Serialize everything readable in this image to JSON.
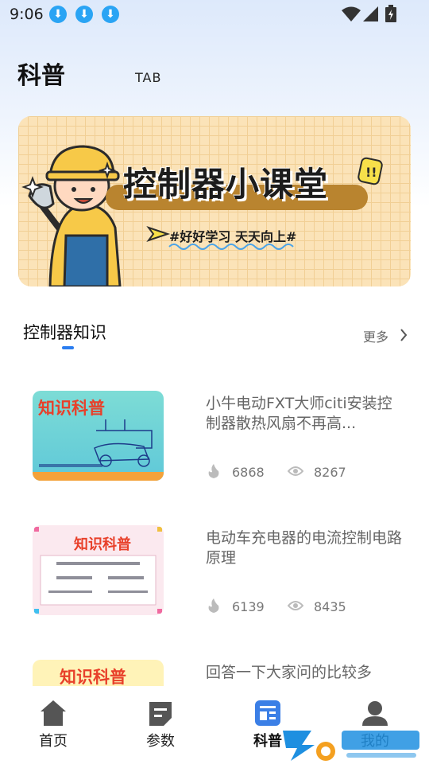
{
  "status_bar": {
    "time": "9:06"
  },
  "header": {
    "title": "科普",
    "tab": "TAB"
  },
  "banner": {
    "title": "控制器小课堂",
    "slogan": "#好好学习 天天向上#"
  },
  "section": {
    "title": "控制器知识",
    "more": "更多"
  },
  "articles": [
    {
      "title": "小牛电动FXT大师citi安装控制器散热风扇不再高...",
      "thumb_label": "知识科普",
      "likes": "6868",
      "views": "8267"
    },
    {
      "title": "电动车充电器的电流控制电路原理",
      "thumb_label": "知识科普",
      "likes": "6139",
      "views": "8435"
    },
    {
      "title": "回答一下大家问的比较多",
      "thumb_label": "知识科普"
    }
  ],
  "nav": [
    {
      "label": "首页",
      "icon": "home-icon"
    },
    {
      "label": "参数",
      "icon": "params-icon"
    },
    {
      "label": "科普",
      "icon": "science-icon",
      "active": true
    },
    {
      "label": "我的",
      "icon": "user-icon"
    }
  ],
  "colors": {
    "accent": "#2a7df0",
    "download_icon": "#2aa4f4",
    "banner_bg": "#fbe3b8"
  }
}
